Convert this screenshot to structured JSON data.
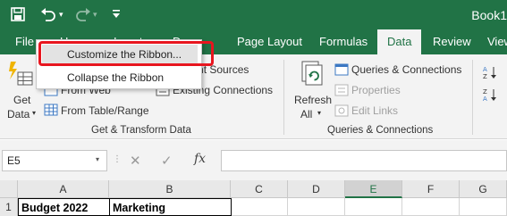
{
  "title_bar": {
    "book_title": "Book1",
    "icons": [
      "save-icon",
      "undo-icon",
      "undo-dropdown-icon",
      "redo-icon",
      "redo-dropdown-icon",
      "customize-qat-icon"
    ]
  },
  "tabs": {
    "file": "File",
    "home": "Home",
    "insert": "Insert",
    "draw": "Draw",
    "page_layout": "Page Layout",
    "formulas": "Formulas",
    "data": "Data",
    "review": "Review",
    "view": "View"
  },
  "context_menu": {
    "customize": "Customize the Ribbon...",
    "collapse": "Collapse the Ribbon"
  },
  "ribbon": {
    "get_data_line1": "Get",
    "get_data_line2": "Data",
    "from_web": "From Web",
    "from_table": "From Table/Range",
    "recent_sources": "Recent Sources",
    "existing_connections": "Existing Connections",
    "get_transform_label": "Get & Transform Data",
    "refresh_line1": "Refresh",
    "refresh_line2": "All",
    "queries_connections": "Queries & Connections",
    "properties": "Properties",
    "edit_links": "Edit Links",
    "queries_group_label": "Queries & Connections"
  },
  "formula_bar": {
    "name_box": "E5",
    "fx": "fx",
    "value": ""
  },
  "grid": {
    "columns": [
      "A",
      "B",
      "C",
      "D",
      "E",
      "F",
      "G"
    ],
    "selected_column": "E",
    "row_number": "1",
    "cell_a1": "Budget 2022",
    "cell_b1": "Marketing"
  },
  "colors": {
    "excel_green": "#217346",
    "highlight_red": "#e8161f"
  }
}
